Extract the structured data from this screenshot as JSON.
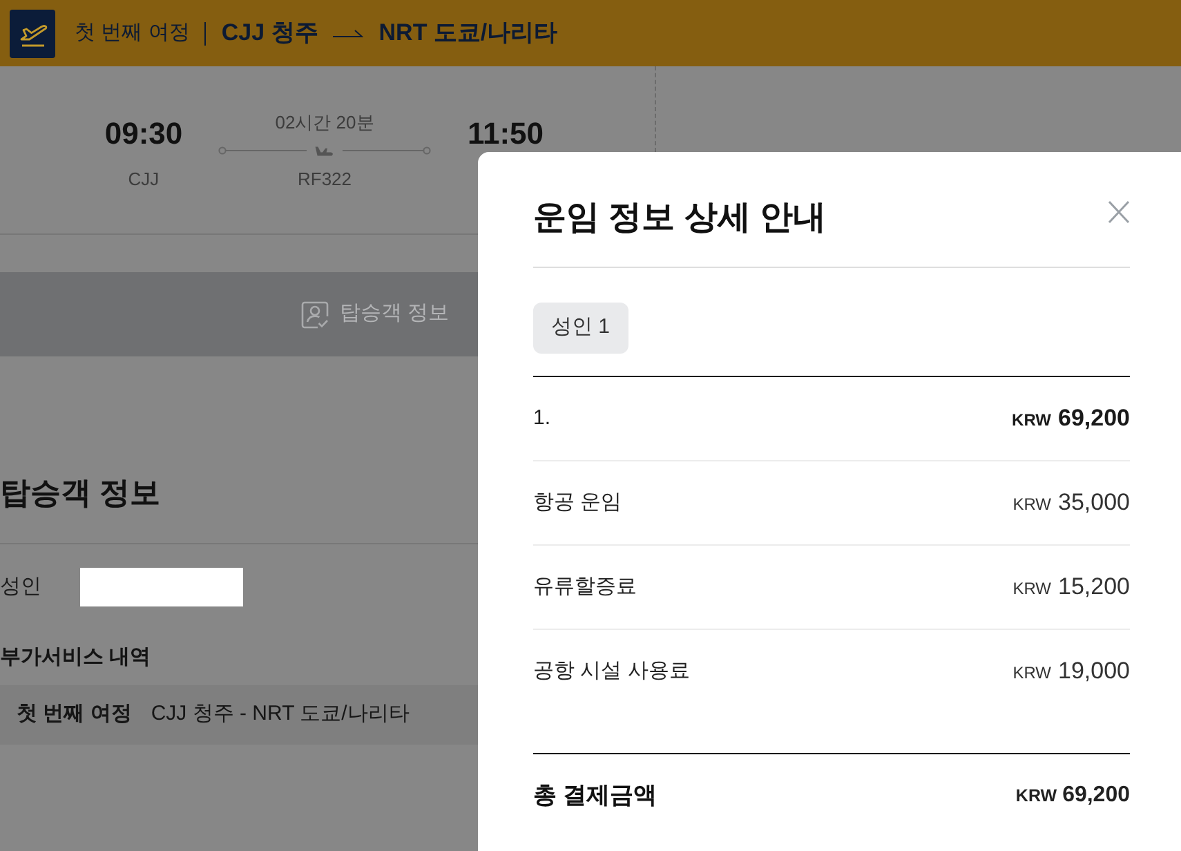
{
  "header": {
    "trip_label": "첫 번째 여정",
    "origin": "CJJ 청주",
    "destination": "NRT 도쿄/나리타"
  },
  "flight": {
    "departure_time": "09:30",
    "departure_airport": "CJJ",
    "duration": "02시간 20분",
    "flight_number": "RF322",
    "arrival_time": "11:50"
  },
  "passenger_bar": {
    "label": "탑승객 정보"
  },
  "passenger_info": {
    "title": "탑승객 정보",
    "passengers": [
      {
        "type": "성인",
        "name_redacted": true
      }
    ],
    "services_title": "부가서비스 내역",
    "services": [
      {
        "trip": "첫 번째 여정",
        "route": "CJJ 청주 - NRT 도쿄/나리타"
      }
    ]
  },
  "fare_modal": {
    "title": "운임 정보 상세 안내",
    "passenger_chip": "성인 1",
    "rows": [
      {
        "kind": "subtotal",
        "label": "1.",
        "currency": "KRW",
        "amount": "69,200"
      },
      {
        "kind": "item",
        "label": "항공 운임",
        "currency": "KRW",
        "amount": "35,000"
      },
      {
        "kind": "item",
        "label": "유류할증료",
        "currency": "KRW",
        "amount": "15,200"
      },
      {
        "kind": "item",
        "label": "공항 시설 사용료",
        "currency": "KRW",
        "amount": "19,000"
      }
    ],
    "total": {
      "label": "총 결제금액",
      "currency": "KRW",
      "amount": "69,200"
    }
  }
}
